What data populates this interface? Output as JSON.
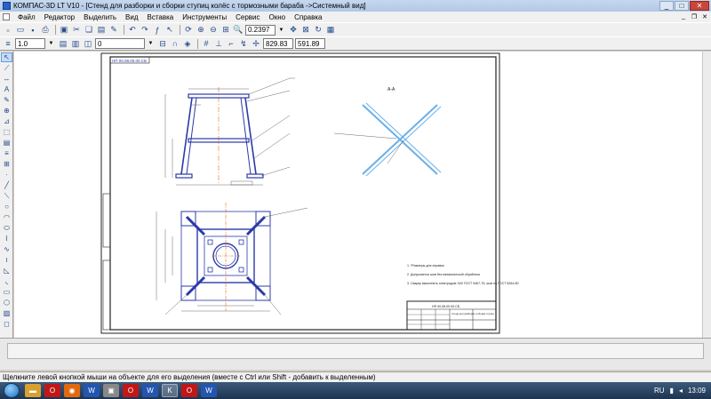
{
  "window": {
    "title": "КОМПАС-3D LT V10 - [Стенд для разборки и сборки ступиц колёс с тормозными бараба ->Системный вид]"
  },
  "menu": {
    "items": [
      "Файл",
      "Редактор",
      "Выделить",
      "Вид",
      "Вставка",
      "Инструменты",
      "Сервис",
      "Окно",
      "Справка"
    ]
  },
  "toolbar": {
    "zoom_value": "0.2397",
    "line_scale": "1.0",
    "layer_value": "0",
    "coord_x": "829.83",
    "coord_y": "591.89"
  },
  "drawing": {
    "stamp_top": "НП 00.08.00.00.СБ",
    "section_label": "А-А",
    "notes": [
      "1. *Размеры для справки",
      "2. Допускается шов без механической обработки",
      "3. Сварку выполнять электродом Э42 ГОСТ 9467-75, шов по ГОСТ 5264-80"
    ],
    "title_block_code": "НП 00.08.00.00.СБ",
    "title_block_name": "Стенд для разборки и сборки ступиц"
  },
  "status": {
    "text": "Щелкните левой кнопкой мыши на объекте для его выделения (вместе с Ctrl или Shift - добавить к выделенным)"
  },
  "taskbar": {
    "lang": "RU",
    "time": "13:09"
  },
  "colors": {
    "frame_blue": "#2b3aa8",
    "centerline_orange": "#e07020",
    "section_lightblue": "#6ab0e8"
  }
}
